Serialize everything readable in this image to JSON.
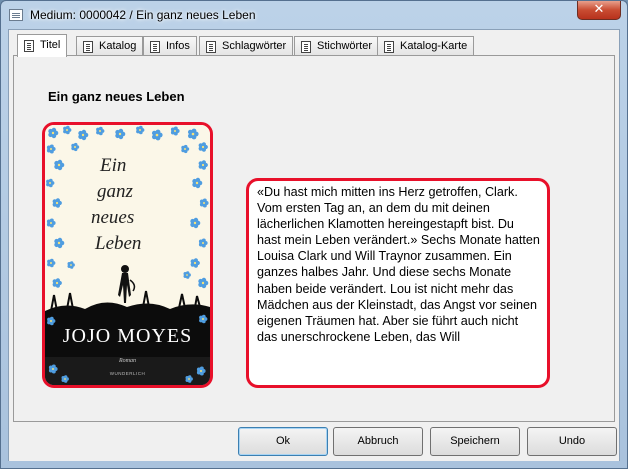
{
  "window": {
    "title": "Medium: 0000042 / Ein ganz neues Leben",
    "close_symbol": "✕"
  },
  "tabs": [
    {
      "label": "Titel",
      "active": true
    },
    {
      "label": "Katalog",
      "active": false
    },
    {
      "label": "Infos",
      "active": false
    },
    {
      "label": "Schlagwörter",
      "active": false
    },
    {
      "label": "Stichwörter",
      "active": false
    },
    {
      "label": "Katalog-Karte",
      "active": false
    }
  ],
  "book": {
    "title": "Ein ganz neues Leben",
    "cover": {
      "title_lines": [
        "Ein",
        "ganz",
        "neues",
        "Leben"
      ],
      "author": "JOJO MOYES",
      "genre": "Roman",
      "publisher": "WUNDERLICH"
    },
    "blurb": "«Du hast mich mitten ins Herz getroffen, Clark. Vom ersten Tag an, an dem du mit deinen lächerlichen Klamotten hereingestapft bist. Du hast mein Leben verändert.» Sechs Monate hatten Louisa Clark und Will Traynor zusammen. Ein ganzes halbes Jahr. Und diese sechs Monate haben beide verändert. Lou ist nicht mehr das Mädchen aus der Kleinstadt, das Angst vor seinen eigenen Träumen hat. Aber sie führt auch nicht das unerschrockene Leben, das Will"
  },
  "buttons": {
    "ok": "Ok",
    "cancel": "Abbruch",
    "save": "Speichern",
    "undo": "Undo"
  },
  "colors": {
    "highlight": "#e8102a",
    "cover_bg": "#fbf7e8",
    "flower_blue": "#4f9de0"
  }
}
